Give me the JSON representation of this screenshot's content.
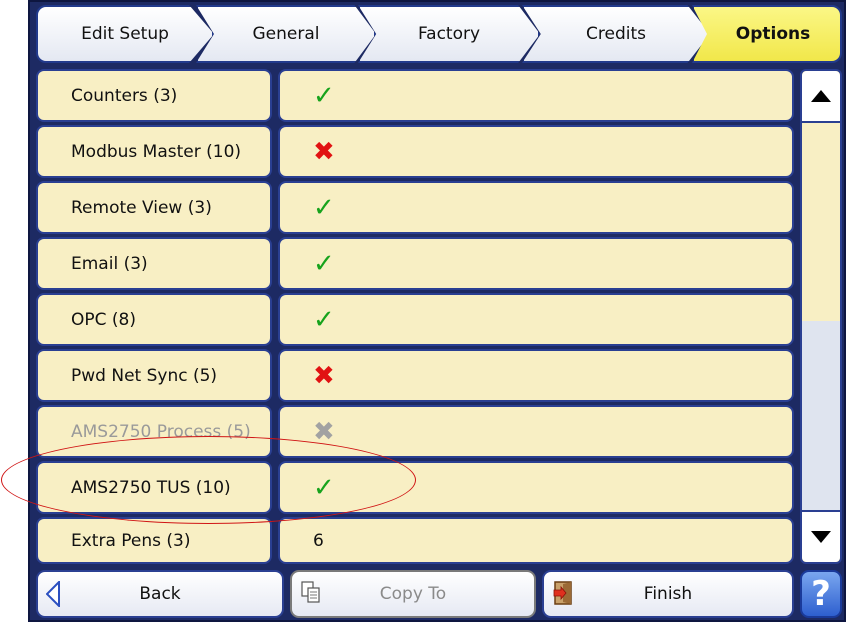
{
  "breadcrumb": {
    "tabs": [
      {
        "label": "Edit Setup"
      },
      {
        "label": "General"
      },
      {
        "label": "Factory"
      },
      {
        "label": "Credits"
      },
      {
        "label": "Options",
        "active": true
      }
    ]
  },
  "options": [
    {
      "label": "Counters (3)",
      "status": "enabled",
      "mark": "✓"
    },
    {
      "label": "Modbus Master (10)",
      "status": "disabled",
      "mark": "✖"
    },
    {
      "label": "Remote View (3)",
      "status": "enabled",
      "mark": "✓"
    },
    {
      "label": "Email (3)",
      "status": "enabled",
      "mark": "✓"
    },
    {
      "label": "OPC (8)",
      "status": "enabled",
      "mark": "✓"
    },
    {
      "label": "Pwd Net Sync (5)",
      "status": "disabled",
      "mark": "✖"
    },
    {
      "label": "AMS2750 Process (5)",
      "status": "unavailable",
      "mark": "✖"
    },
    {
      "label": "AMS2750 TUS (10)",
      "status": "enabled",
      "mark": "✓"
    },
    {
      "label": "Extra Pens (3)",
      "value": "6"
    }
  ],
  "scrollbar": {
    "up_icon": "triangle-up-icon",
    "down_icon": "triangle-down-icon",
    "position_fraction": 0.0
  },
  "footer": {
    "back_label": "Back",
    "copy_label": "Copy To",
    "finish_label": "Finish",
    "help_label": "?"
  },
  "colors": {
    "frame": "#1d2a63",
    "row_fill": "#f8efc4",
    "active_tab": "#f1e74a",
    "check": "#17a31c",
    "cross": "#e11212",
    "highlight": "#d01515"
  }
}
